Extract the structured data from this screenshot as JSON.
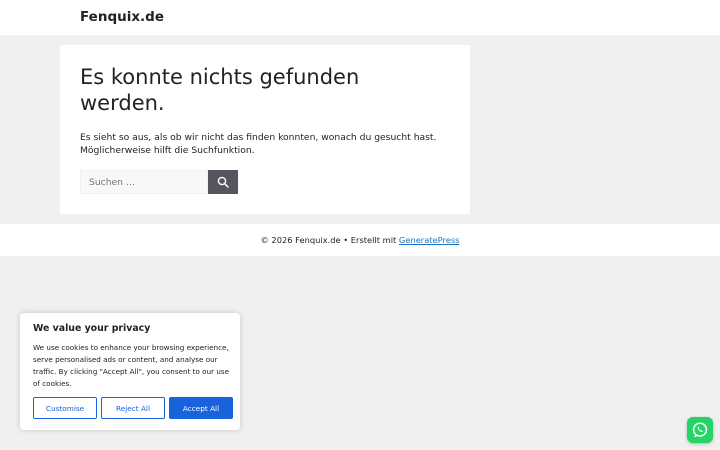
{
  "header": {
    "site_title": "Fenquix.de"
  },
  "main": {
    "title": "Es konnte nichts gefunden werden.",
    "message_line1": "Es sieht so aus, als ob wir nicht das finden konnten, wonach du gesucht hast.",
    "message_line2": "Möglicherweise hilft die Suchfunktion.",
    "search": {
      "placeholder": "Suchen …",
      "value": ""
    }
  },
  "footer": {
    "copyright": "© 2026 Fenquix.de • Erstellt mit ",
    "link_label": "GeneratePress"
  },
  "cookie_banner": {
    "title": "We value your privacy",
    "text": "We use cookies to enhance your browsing experience, serve personalised ads or content, and analyse our traffic. By clicking \"Accept All\", you consent to our use of cookies.",
    "buttons": {
      "customise": "Customise",
      "reject": "Reject All",
      "accept": "Accept All"
    }
  },
  "colors": {
    "background": "#f0f0f0",
    "accent": "#1863dc",
    "search_button": "#55555e",
    "link": "#1e73be",
    "whatsapp": "#25d366"
  },
  "icons": {
    "search_button": "search-icon",
    "floating_chat": "whatsapp-icon"
  }
}
